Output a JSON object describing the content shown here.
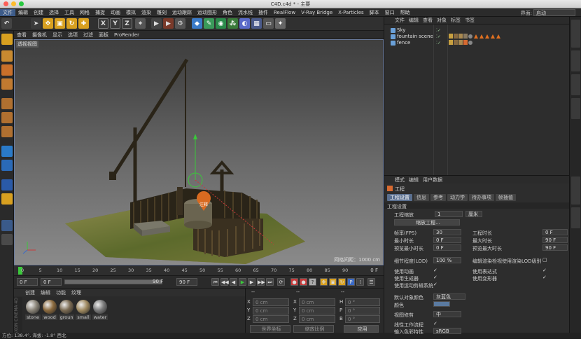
{
  "window": {
    "title": "C4D.c4d * - 主要"
  },
  "menubar": {
    "items": [
      "文件",
      "编辑",
      "创建",
      "选择",
      "工具",
      "网格",
      "捕捉",
      "动画",
      "模拟",
      "渲染",
      "雕刻",
      "运动跟踪",
      "运动图形",
      "角色",
      "流水线",
      "插件",
      "RealFlow",
      "V-Ray Bridge",
      "X-Particles",
      "脚本",
      "窗口",
      "帮助"
    ],
    "layout_label": "界面:",
    "layout_value": "启动"
  },
  "viewport": {
    "menu": [
      "查看",
      "摄像机",
      "显示",
      "选项",
      "过滤",
      "面板",
      "ProRender"
    ],
    "label": "透视视图",
    "grid_spacing": "网格间距：1000 cm",
    "pin_label": "注释"
  },
  "toolbar": {
    "x_label": "X",
    "y_label": "Y",
    "z_label": "Z"
  },
  "timeline": {
    "ticks": [
      "0",
      "5",
      "10",
      "15",
      "20",
      "25",
      "30",
      "35",
      "40",
      "45",
      "50",
      "55",
      "60",
      "65",
      "70",
      "75",
      "80",
      "85",
      "90"
    ],
    "end_frame": "0 F"
  },
  "transport": {
    "start": "0 F",
    "current": "0 F",
    "end_a": "90 F",
    "end_b": "90 F"
  },
  "materials": {
    "menu": [
      "创建",
      "编辑",
      "功能",
      "纹理"
    ],
    "items": [
      {
        "name": "stone",
        "color": "#8a8478"
      },
      {
        "name": "wood",
        "color": "#8b6a3e"
      },
      {
        "name": "groun",
        "color": "#7a6a52"
      },
      {
        "name": "small",
        "color": "#a08a60"
      },
      {
        "name": "water",
        "color": "#7a7a7a"
      }
    ]
  },
  "coordinates": {
    "headers": [
      "--",
      "--",
      "--"
    ],
    "rows": [
      {
        "axis": "X",
        "pos": "0 cm",
        "axis2": "X",
        "size": "0 cm",
        "rot_label": "H",
        "rot": "0 °"
      },
      {
        "axis": "Y",
        "pos": "0 cm",
        "axis2": "Y",
        "size": "0 cm",
        "rot_label": "P",
        "rot": "0 °"
      },
      {
        "axis": "Z",
        "pos": "0 cm",
        "axis2": "Z",
        "size": "0 cm",
        "rot_label": "B",
        "rot": "0 °"
      }
    ],
    "mode": "世界坐标",
    "scale_mode": "缩放比例",
    "apply": "应用"
  },
  "status": {
    "text": "方位: 138.4°, 海拔: -1.8°  西北"
  },
  "object_manager": {
    "menu": [
      "文件",
      "编辑",
      "查看",
      "对象",
      "标签",
      "书签"
    ],
    "objects": [
      {
        "name": "Sky",
        "color": "#6aa0d8"
      },
      {
        "name": "fountain scene",
        "color": "#6aa0d8"
      },
      {
        "name": "fence",
        "color": "#6aa0d8"
      }
    ]
  },
  "attribute_manager": {
    "menu": [
      "模式",
      "编辑",
      "用户数据"
    ],
    "header": "工程",
    "tabs": [
      "工程设置",
      "信息",
      "参考",
      "动力学",
      "待办事项",
      "帧插值"
    ],
    "section": "工程设置",
    "scale_label": "工程缩放",
    "scale_value": "1",
    "scale_unit": "厘米",
    "scale_button": "缩放工程...",
    "left_fields": [
      {
        "label": "帧率(FPS)",
        "value": "30"
      },
      {
        "label": "最小时长",
        "value": "0 F"
      },
      {
        "label": "预览最小时长",
        "value": "0 F"
      },
      {
        "label": "细节程度(LOD)",
        "value": "100 %"
      }
    ],
    "right_fields": [
      {
        "label": "工程时长",
        "value": "0 F"
      },
      {
        "label": "最大时长",
        "value": "90 F"
      },
      {
        "label": "预览最大时长",
        "value": "90 F"
      }
    ],
    "lod_check_label": "编辑渲染检视使用渲染LOD级别",
    "checks_left": [
      "使用动画",
      "使用生成器",
      "使用运动剪辑系统"
    ],
    "checks_right": [
      "使用表达式",
      "使用变形器"
    ],
    "default_color_label": "默认对象颜色",
    "default_color_value": "灰蓝色",
    "color_label": "颜色",
    "view_correction_label": "视图修剪",
    "view_correction_value": "中",
    "linear_workflow_label": "线性工作流程",
    "input_color_label": "输入色彩特性",
    "input_color_value": "sRGB"
  }
}
